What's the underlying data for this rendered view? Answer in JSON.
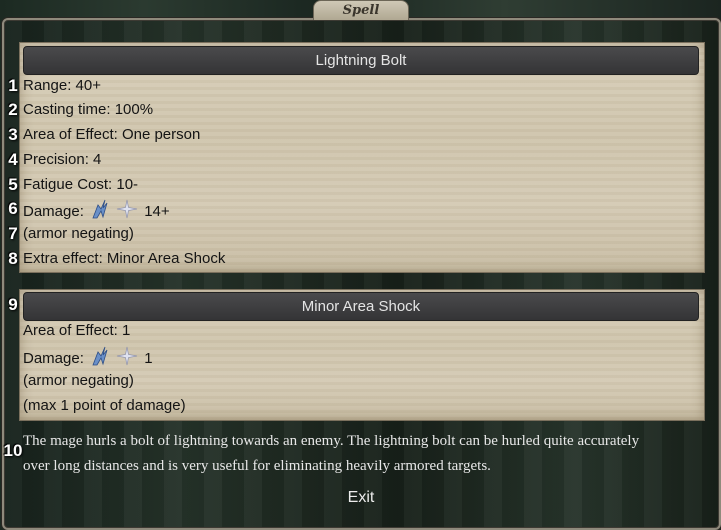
{
  "window": {
    "title": "Spell"
  },
  "spell": {
    "name": "Lightning Bolt",
    "range": "Range: 40+",
    "casting_time": "Casting time: 100%",
    "area_of_effect": "Area of Effect: One person",
    "precision": "Precision: 4",
    "fatigue_cost": "Fatigue Cost: 10-",
    "damage_label": "Damage:",
    "damage_value": "14+",
    "armor_note": "(armor negating)",
    "extra_effect": "Extra effect: Minor Area Shock"
  },
  "extra_effect": {
    "name": "Minor Area Shock",
    "area_of_effect": "Area of Effect: 1",
    "damage_label": "Damage:",
    "damage_value": "1",
    "armor_note": "(armor negating)",
    "max_note": "(max 1 point of damage)"
  },
  "description_line_1": "The mage hurls a bolt of lightning towards an enemy. The lightning bolt can be hurled quite accurately",
  "description_line_2": "over long distances and is very useful for eliminating heavily armored targets.",
  "markers": [
    "1",
    "2",
    "3",
    "4",
    "5",
    "6",
    "7",
    "8",
    "9",
    "10"
  ],
  "icons": {
    "damage_type": "lightning-icon",
    "spark": "spark-icon"
  },
  "buttons": {
    "exit": "Exit"
  }
}
